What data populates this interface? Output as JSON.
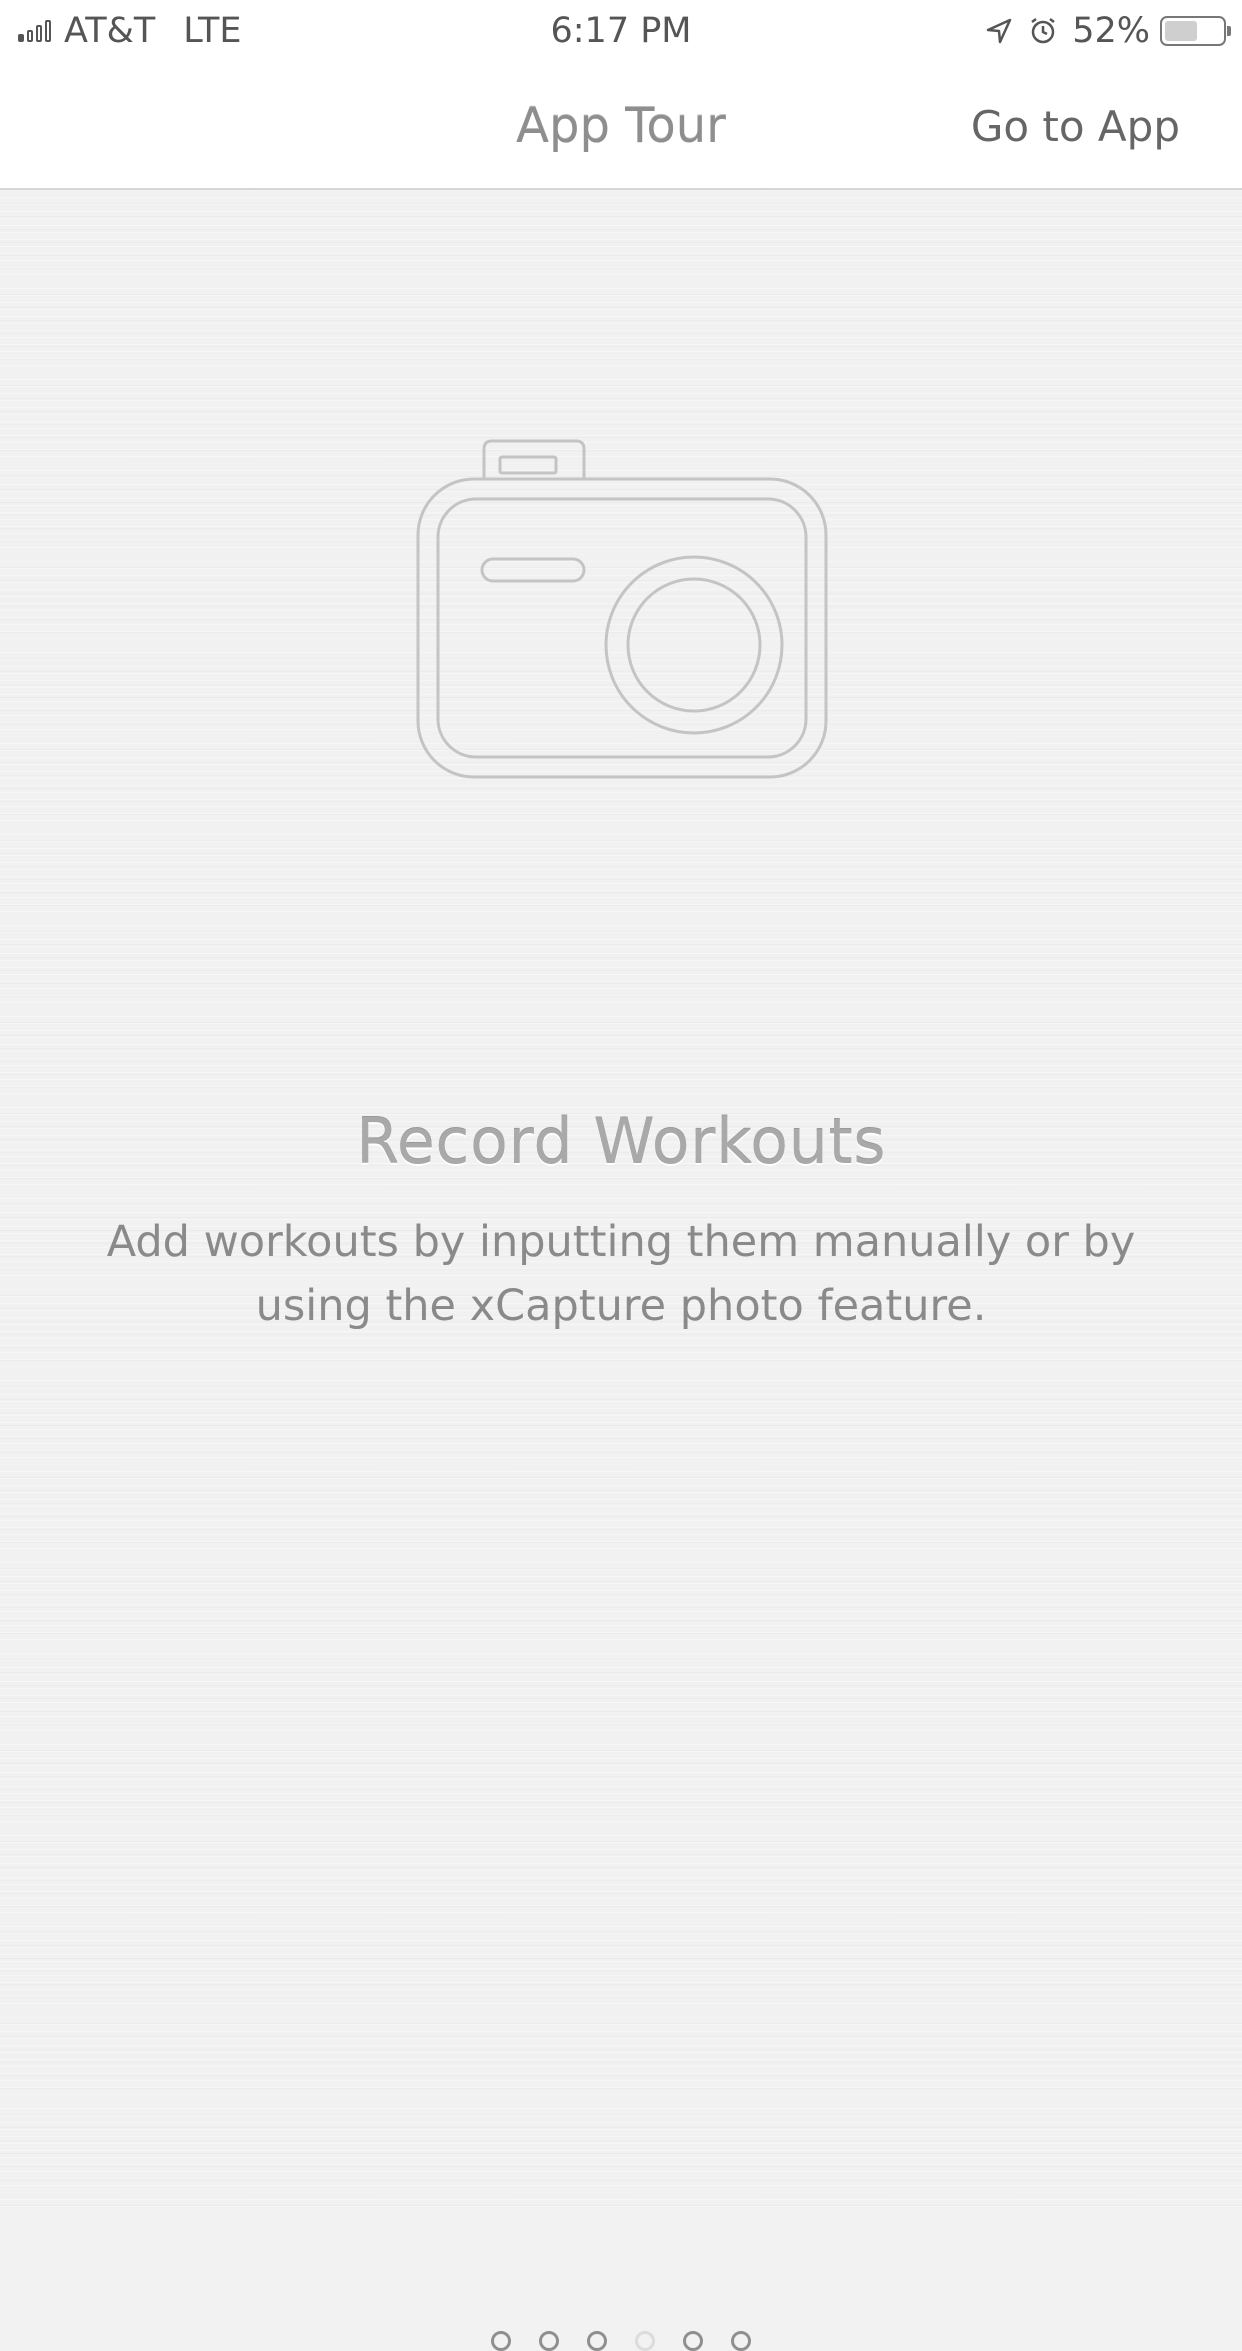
{
  "status_bar": {
    "carrier": "AT&T",
    "network": "LTE",
    "time": "6:17 PM",
    "battery_percent": "52%",
    "battery_level": 0.52,
    "signal_bars_filled": 1,
    "signal_bars_total": 4,
    "icons": [
      "signal-icon",
      "location-arrow-icon",
      "alarm-icon",
      "battery-icon"
    ]
  },
  "nav": {
    "title": "App Tour",
    "action_label": "Go to App"
  },
  "slide": {
    "icon": "camera-icon",
    "headline": "Record Workouts",
    "description": "Add workouts by inputting them manually or by using the xCapture photo feature."
  },
  "pagination": {
    "total": 6,
    "current_index": 3
  },
  "colors": {
    "background": "#f1f1f1",
    "bar_background": "#ffffff",
    "text": "#8a8a8a",
    "icon_stroke": "#c4c4c4"
  }
}
